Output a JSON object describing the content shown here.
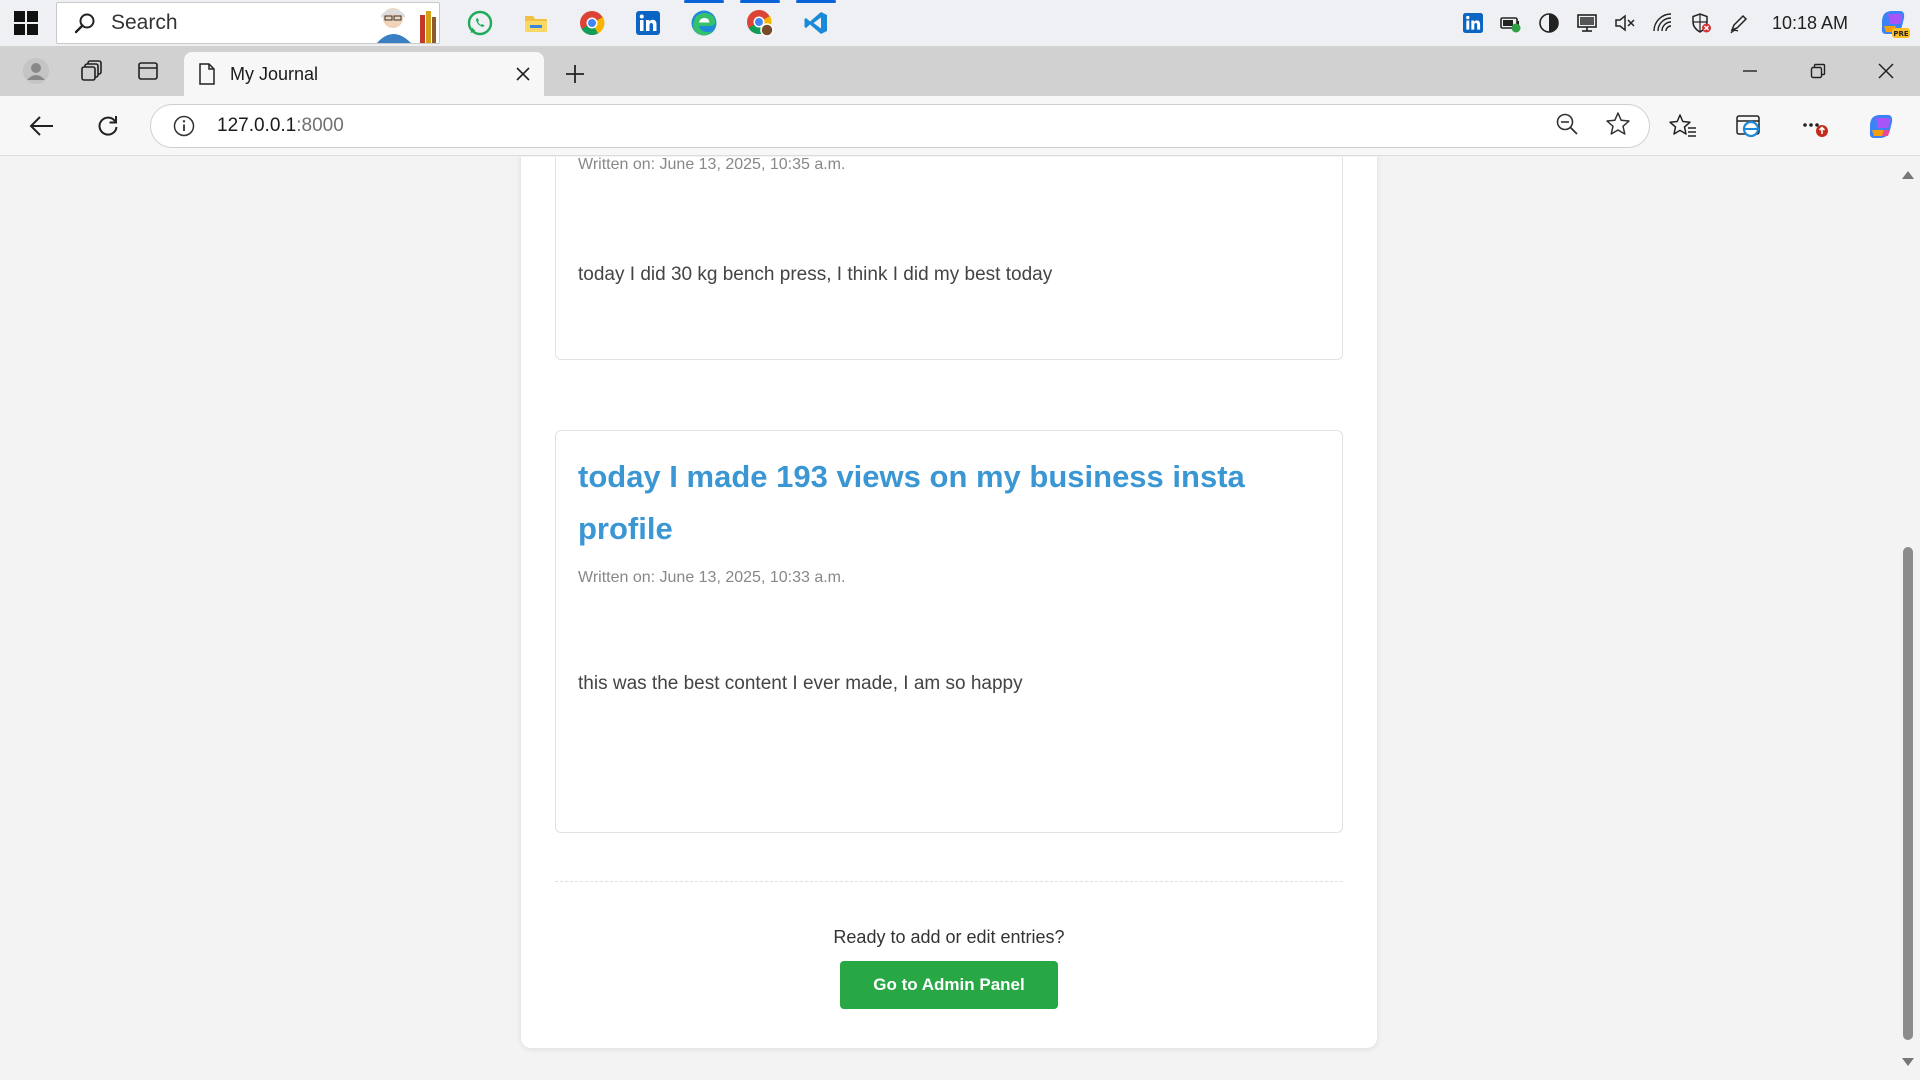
{
  "taskbar": {
    "search_label": "Search",
    "apps": [
      "whatsapp-icon",
      "file-explorer-icon",
      "chrome-icon",
      "linkedin-icon",
      "edge-icon",
      "chrome-profile-icon",
      "vscode-icon"
    ],
    "clock": "10:18 AM"
  },
  "browser": {
    "tab_title": "My Journal",
    "url_host": "127.0.0.1",
    "url_port": ":8000"
  },
  "entries": [
    {
      "date": "Written on: June 13, 2025, 10:35 a.m.",
      "body": "today I did 30 kg bench press, I think I did my best today"
    },
    {
      "title": "today I made 193 views on my business insta profile",
      "date": "Written on: June 13, 2025, 10:33 a.m.",
      "body": "this was the best content I ever made, I am so happy"
    }
  ],
  "cta": {
    "prompt": "Ready to add or edit entries?",
    "button_label": "Go to Admin Panel"
  },
  "colors": {
    "heading_blue": "#3b97d4",
    "button_green": "#28a745"
  }
}
